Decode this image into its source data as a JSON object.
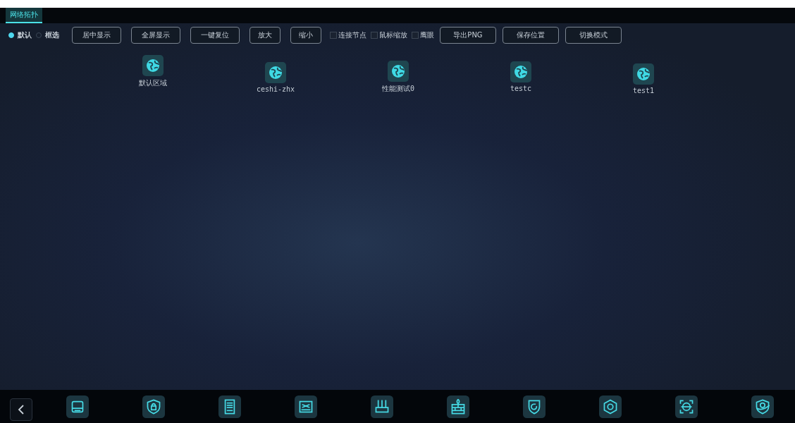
{
  "tabs": [
    {
      "label": "网络拓扑",
      "selected": true
    }
  ],
  "select_modes": [
    {
      "label": "默认",
      "selected": true
    },
    {
      "label": "框选",
      "selected": false
    }
  ],
  "toolbar_buttons": [
    "居中显示",
    "全屏显示",
    "一键复位",
    "放大",
    "缩小"
  ],
  "options": [
    {
      "label": "连接节点",
      "checked": false
    },
    {
      "label": "鼠标缩放",
      "checked": false
    },
    {
      "label": "鹰眼",
      "checked": false
    }
  ],
  "action_buttons": [
    "导出PNG",
    "保存位置",
    "切换模式"
  ],
  "nodes": [
    {
      "label": "默认区域"
    },
    {
      "label": "ceshi-zhx"
    },
    {
      "label": "性能测试0"
    },
    {
      "label": "testc"
    },
    {
      "label": "test1"
    }
  ],
  "dock": {
    "items": [
      {
        "kind": "server"
      },
      {
        "kind": "shield-lock"
      },
      {
        "kind": "rack"
      },
      {
        "kind": "switch"
      },
      {
        "kind": "router"
      },
      {
        "kind": "firewall"
      },
      {
        "kind": "shield-refresh"
      },
      {
        "kind": "hexagon"
      },
      {
        "kind": "scan"
      },
      {
        "kind": "shield-globe"
      }
    ]
  }
}
